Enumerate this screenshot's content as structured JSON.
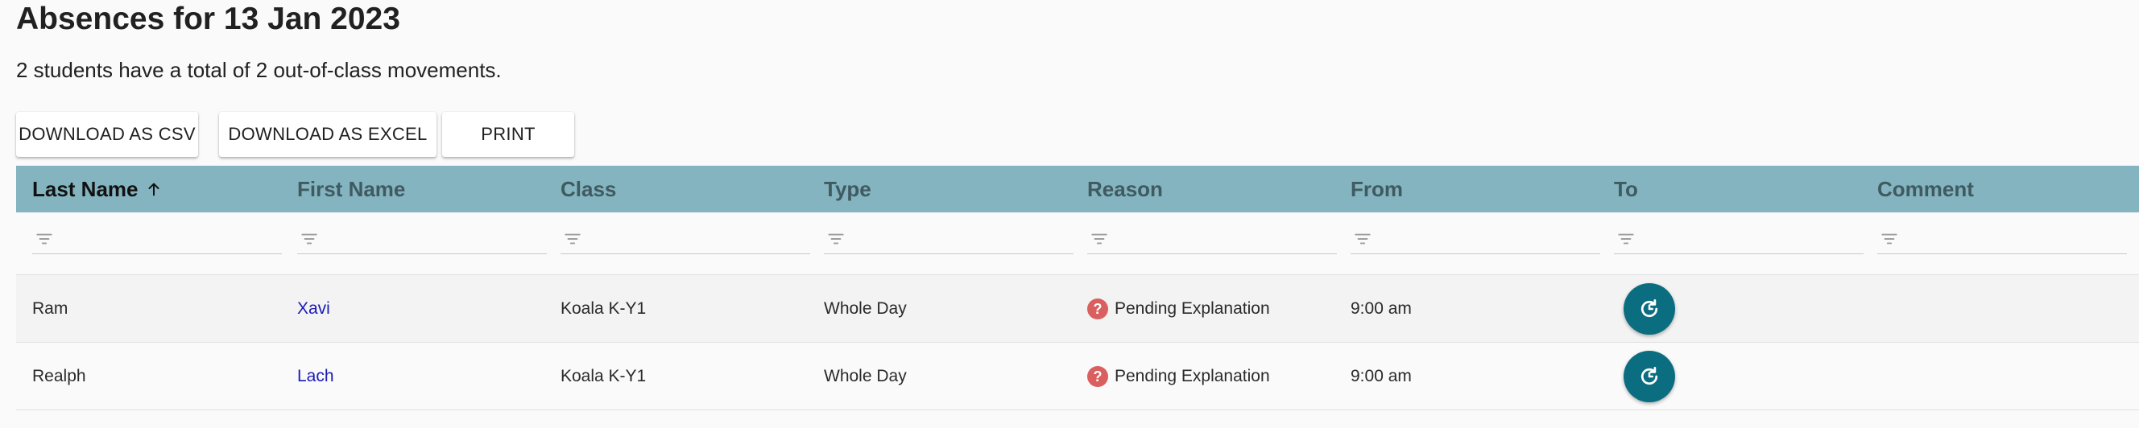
{
  "page": {
    "title": "Absences for 13 Jan 2023",
    "summary": "2 students have a total of 2 out-of-class movements."
  },
  "actions": {
    "csv_label": "DOWNLOAD AS CSV",
    "excel_label": "DOWNLOAD AS EXCEL",
    "print_label": "PRINT"
  },
  "table": {
    "columns": [
      {
        "label": "Last Name",
        "sorted": "ascending"
      },
      {
        "label": "First Name"
      },
      {
        "label": "Class"
      },
      {
        "label": "Type"
      },
      {
        "label": "Reason"
      },
      {
        "label": "From"
      },
      {
        "label": "To"
      },
      {
        "label": "Comment"
      }
    ],
    "rows": [
      {
        "last_name": "Ram",
        "first_name": "Xavi",
        "class": "Koala K-Y1",
        "type": "Whole Day",
        "reason": "Pending Explanation",
        "reason_icon": "question-icon",
        "from": "9:00 am",
        "to": "",
        "comment": ""
      },
      {
        "last_name": "Realph",
        "first_name": "Lach",
        "class": "Koala K-Y1",
        "type": "Whole Day",
        "reason": "Pending Explanation",
        "reason_icon": "question-icon",
        "from": "9:00 am",
        "to": "",
        "comment": ""
      }
    ]
  },
  "colors": {
    "header_bg": "#84b4bf",
    "action_button": "#0b6e80",
    "pending_icon": "#d9605e",
    "link": "#1a1ab8"
  }
}
